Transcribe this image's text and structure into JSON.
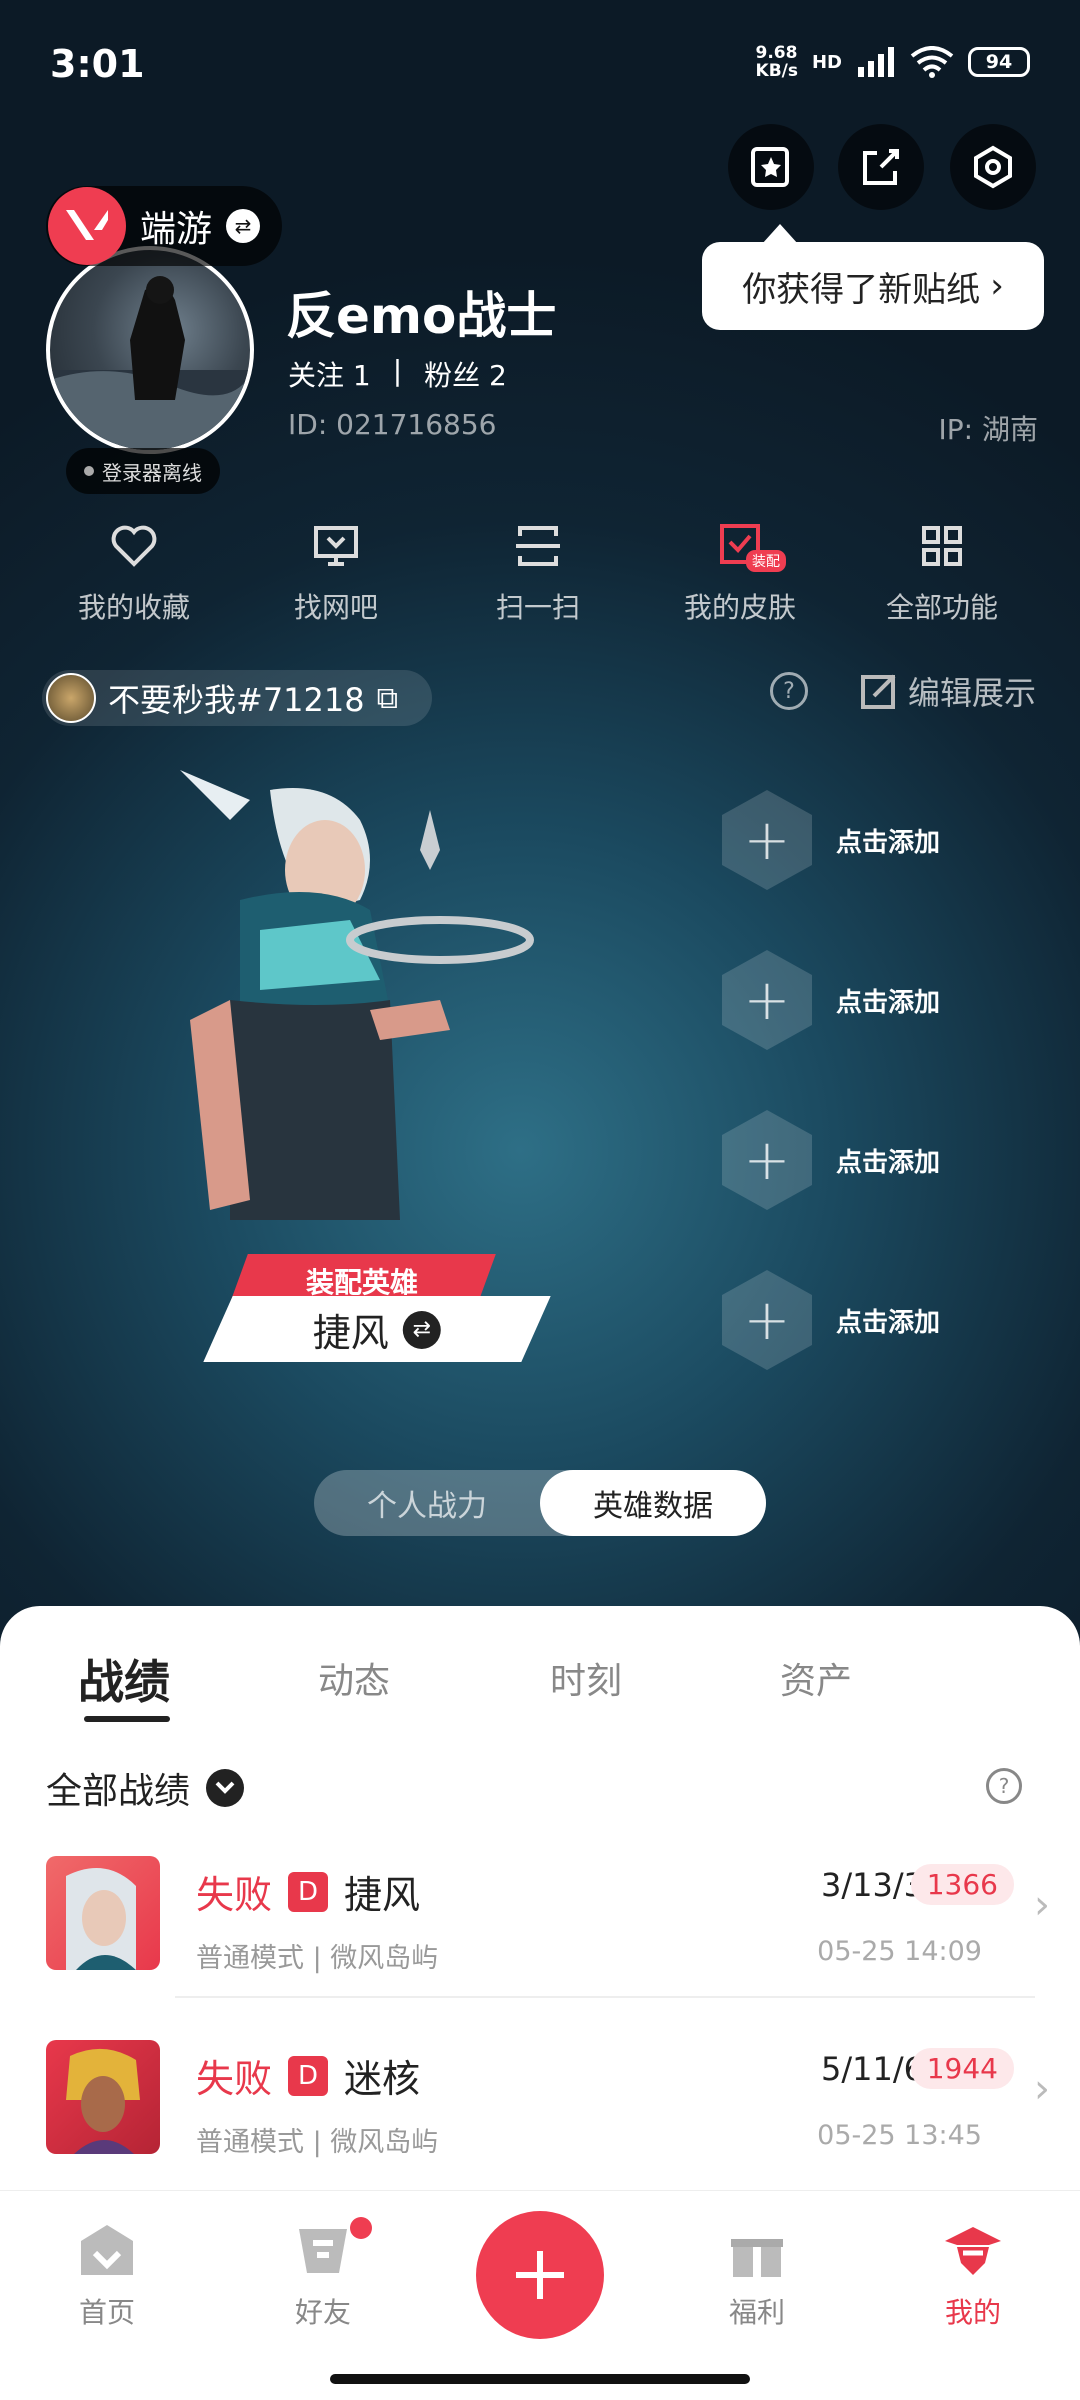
{
  "status_bar": {
    "time": "3:01",
    "net_speed": "9.68",
    "net_unit": "KB/s",
    "hd": "HD",
    "battery": "94"
  },
  "tooltip": {
    "text": "你获得了新贴纸"
  },
  "profile": {
    "game_tag": "端游",
    "status": "登录器离线",
    "nickname": "反emo战士",
    "follow_label": "关注 1",
    "separator": "|",
    "fans_label": "粉丝 2",
    "id": "ID: 021716856",
    "ip": "IP: 湖南"
  },
  "quick_menu": [
    {
      "label": "我的收藏",
      "icon": "heart-icon"
    },
    {
      "label": "找网吧",
      "icon": "monitor-icon"
    },
    {
      "label": "扫一扫",
      "icon": "scan-icon"
    },
    {
      "label": "我的皮肤",
      "icon": "skin-icon",
      "badge": "装配"
    },
    {
      "label": "全部功能",
      "icon": "grid-icon"
    }
  ],
  "player_tag": {
    "name": "不要秒我#71218"
  },
  "edit_label": "编辑展示",
  "hero": {
    "equip_label": "装配英雄",
    "name": "捷风"
  },
  "slots": [
    "点击添加",
    "点击添加",
    "点击添加",
    "点击添加"
  ],
  "segment": {
    "left": "个人战力",
    "right": "英雄数据"
  },
  "tabs": [
    "战绩",
    "动态",
    "时刻",
    "资产"
  ],
  "records_title": "全部战绩",
  "records": [
    {
      "result": "失败",
      "grade": "D",
      "hero": "捷风",
      "mode": "普通模式 | 微风岛屿",
      "kda": "3/13/3",
      "score": "1366",
      "time": "05-25 14:09"
    },
    {
      "result": "失败",
      "grade": "D",
      "hero": "迷核",
      "mode": "普通模式 | 微风岛屿",
      "kda": "5/11/6",
      "score": "1944",
      "time": "05-25 13:45"
    }
  ],
  "nav": {
    "home": "首页",
    "friends": "好友",
    "welfare": "福利",
    "mine": "我的"
  },
  "colors": {
    "accent": "#ef3d51",
    "sheet": "#ffffff"
  }
}
